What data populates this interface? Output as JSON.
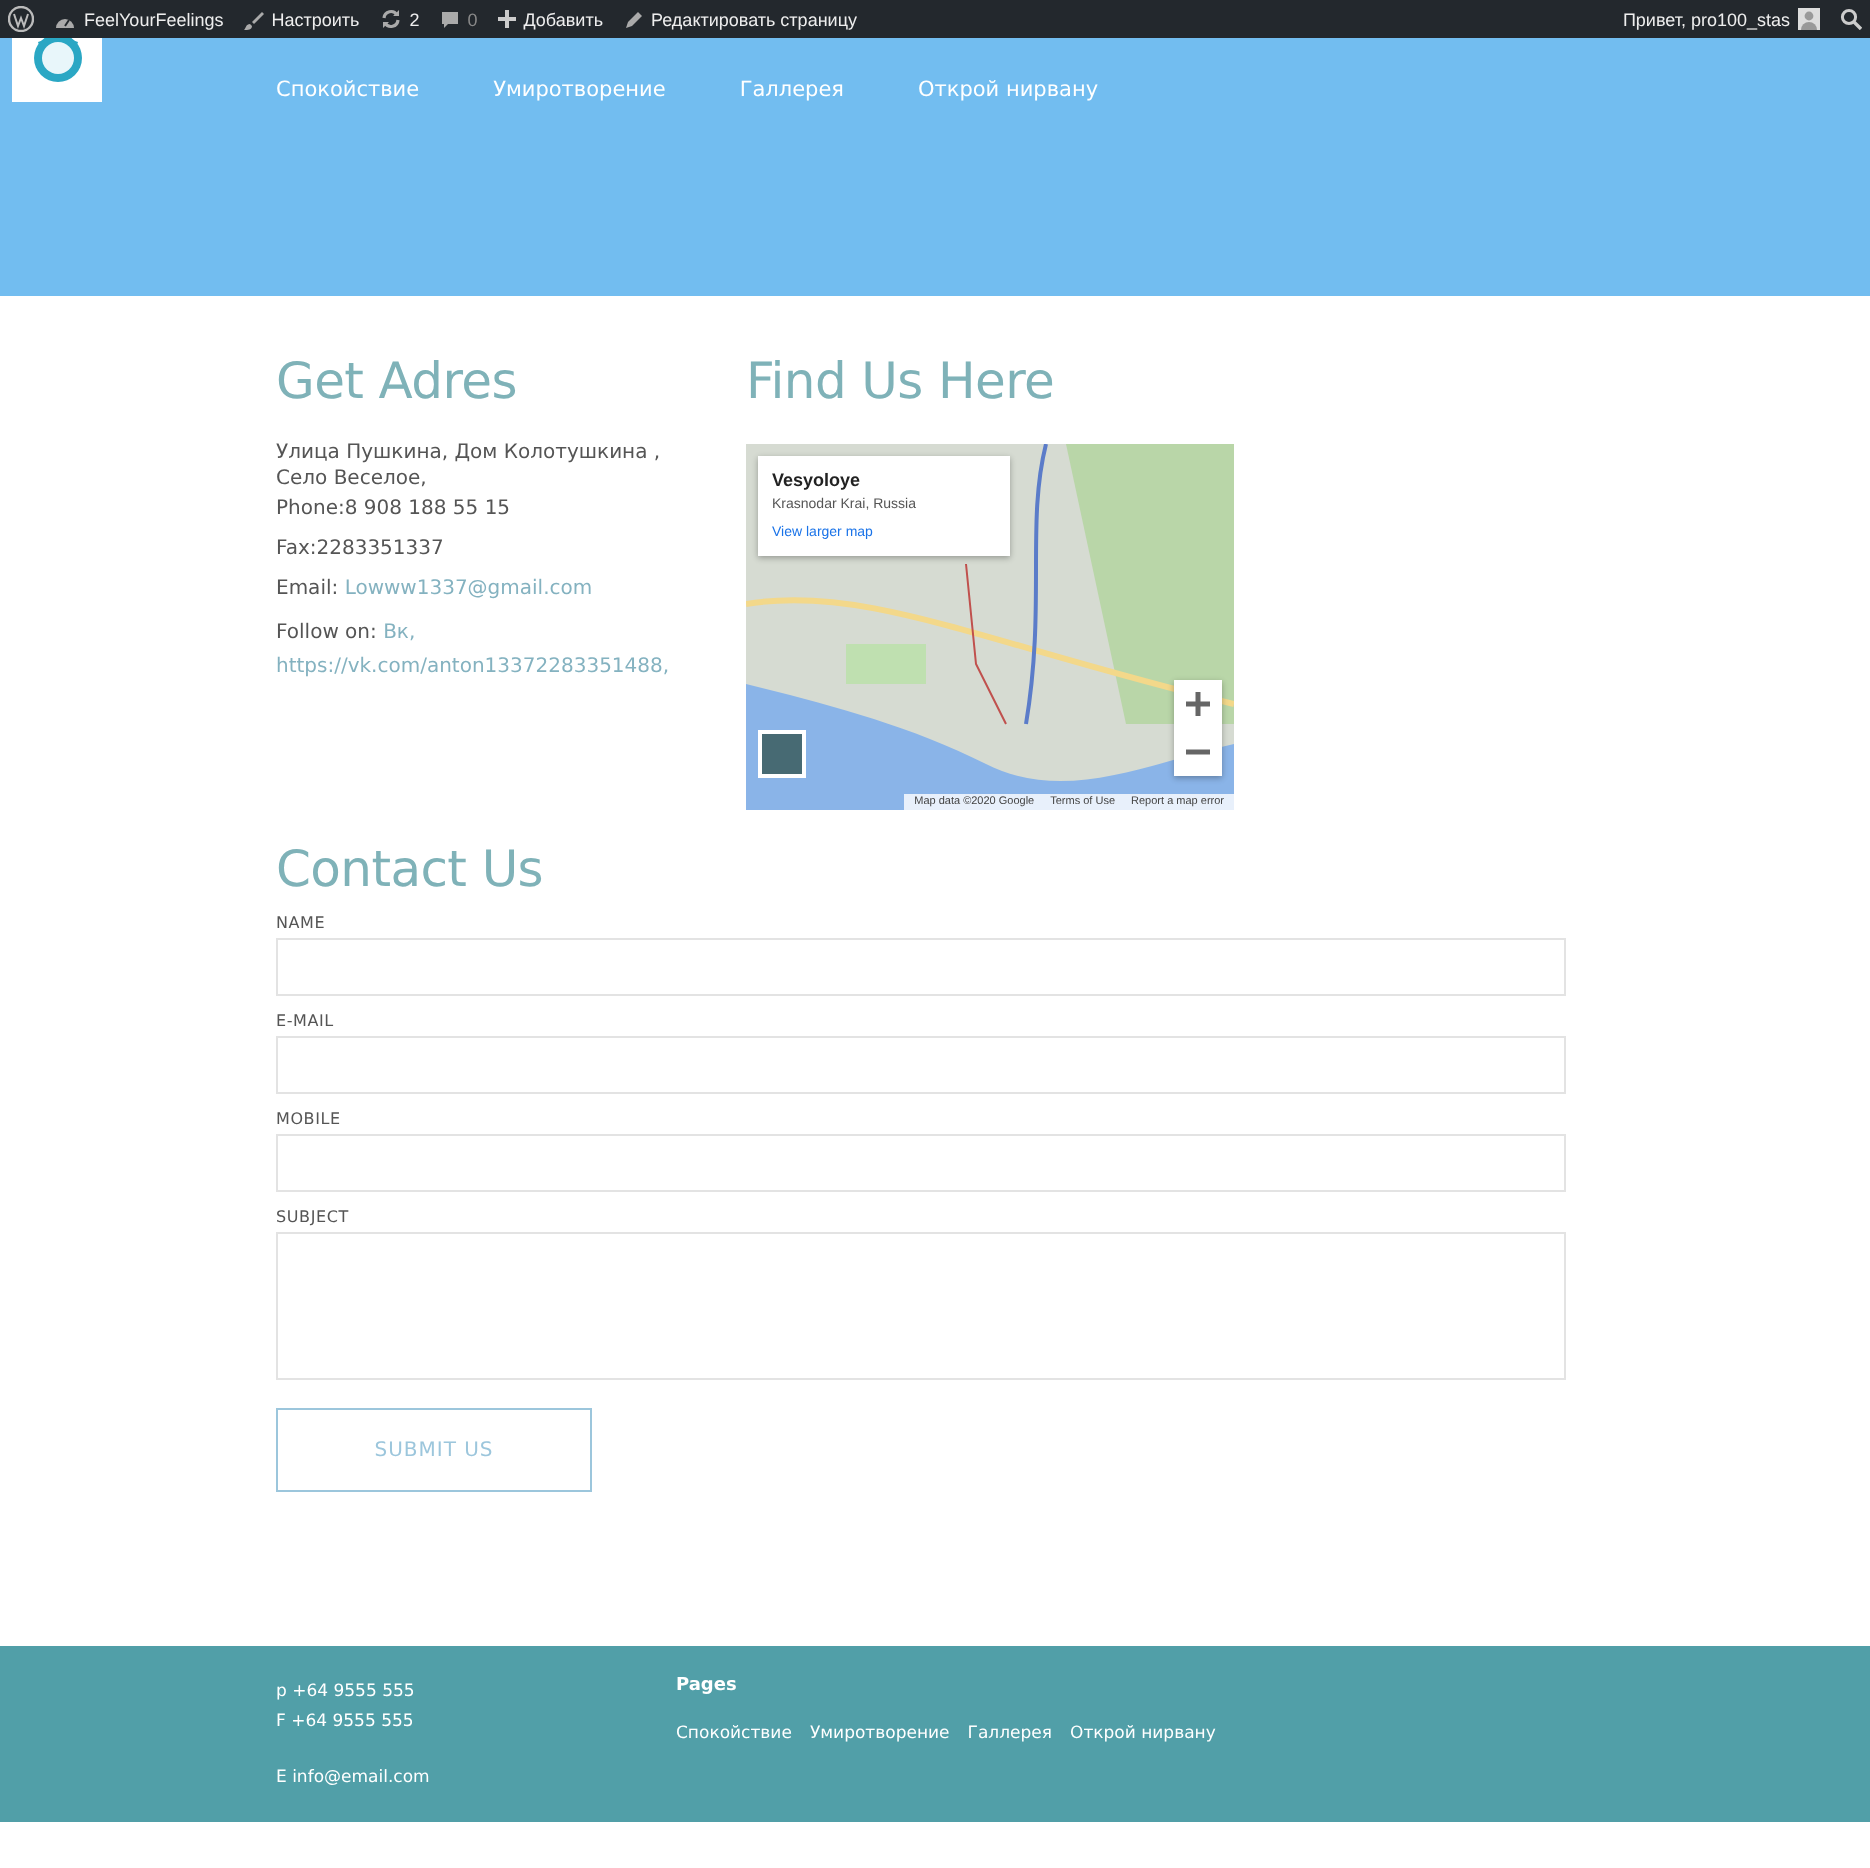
{
  "admin_bar": {
    "site": "FeelYourFeelings",
    "customize": "Настроить",
    "updates": "2",
    "comments": "0",
    "add": "Добавить",
    "edit": "Редактировать страницу",
    "greeting": "Привет, pro100_stas"
  },
  "header": {
    "nav": [
      "Спокойствие",
      "Умиротворение",
      "Галлерея",
      "Открой нирвану"
    ]
  },
  "address": {
    "title": "Get Adres",
    "street": "Улица Пушкина, Дом Колотушкина , Село Веселое,",
    "phone": "Phone:8 908 188 55 15",
    "fax": "Fax:2283351337",
    "email_label": "Email:",
    "email": "Lowww1337@gmail.com",
    "follow_label": "Follow on:",
    "follow_links": [
      "Вк,",
      "https://vk.com/anton13372283351488,"
    ]
  },
  "map": {
    "title": "Find Us Here",
    "place": "Vesyoloye",
    "region": "Krasnodar Krai, Russia",
    "link": "View larger map",
    "attribution": [
      "Map data ©2020 Google",
      "Terms of Use",
      "Report a map error"
    ]
  },
  "contact": {
    "title": "Contact Us",
    "fields": [
      {
        "label": "NAME",
        "kind": "input"
      },
      {
        "label": "E-MAIL",
        "kind": "input"
      },
      {
        "label": "MOBILE",
        "kind": "input"
      },
      {
        "label": "SUBJECT",
        "kind": "textarea"
      }
    ],
    "submit": "SUBMIT US"
  },
  "footer": {
    "contacts": [
      "p +64 9555 555",
      "F +64 9555 555",
      "E info@email.com"
    ],
    "pages_title": "Pages",
    "pages": [
      "Спокойствие",
      "Умиротворение",
      "Галлерея",
      "Открой нирвану"
    ]
  }
}
